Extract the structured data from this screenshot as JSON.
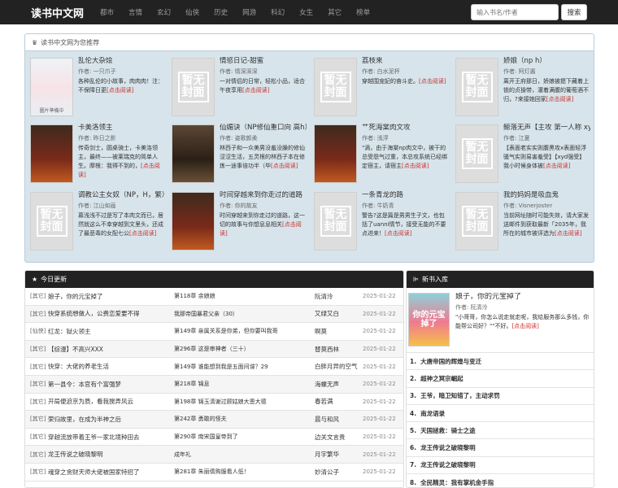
{
  "nav": {
    "brand": "读书中文网",
    "items": [
      "都市",
      "言情",
      "玄幻",
      "仙侠",
      "历史",
      "网游",
      "科幻",
      "女生",
      "其它",
      "榜单"
    ],
    "search_placeholder": "输入书名/作者",
    "search_button": "搜索"
  },
  "recommend": {
    "title": "读书中文网为您推荐",
    "author_prefix": "作者: ",
    "more_label": "[点击阅读]",
    "cover_text": [
      "暂无",
      "封面"
    ],
    "books": [
      {
        "title": "乱伦大杂烩",
        "author": "一只爪子",
        "desc": "各种乱伦的小故事，肉肉肉！注：不保障日更",
        "cover": "image",
        "cover_caption": "圖片準備中"
      },
      {
        "title": "情慾日记-甜蜜",
        "author": "情深深深",
        "desc": "一对情侣的日常，轻松小品，适合午夜享用",
        "cover": "none"
      },
      {
        "title": "荔枝来",
        "author": "白水泥杯",
        "desc": "穿越围宠妃的奋斗史。",
        "cover": "none"
      },
      {
        "title": "娇娘（np h）",
        "author": "阿灯酱",
        "desc": "离开王府那日，娇娘被摁下藏着上锁的贞操带，灌着满腹的葡萄酒不归，?来接她回家",
        "cover": "none"
      },
      {
        "title": "卡美洛领主",
        "author": "昨日之影",
        "desc": "传奇剑士，圆桌骑士，卡美洛领主，最终——被莱瑞克的简单人生。摩根：我得不到的，",
        "cover": "image"
      },
      {
        "title": "仙媚诀（NP修仙重口向 高h）",
        "author": "姿歌颜柔",
        "desc": "林西子和一众美男没羞没臊的修仙涩涩生活，五灵根的林西子本在修炼一途事倍功半（毕",
        "cover": "image"
      },
      {
        "title": "艹死海棠肉文攻",
        "author": "浅浮",
        "desc": "\"滴，由于海棠np肉文中，被干的总受怨气过重，本总攻系统已经绑定宿主，请宿主",
        "cover": "image"
      },
      {
        "title": "鲸落无声【主攻 第一人称 xyd强受】",
        "author": "江夏",
        "desc": "【表面老实实则腹黑攻x表面轻浮骚气实则易害羞受】【xyd强受】我小时候身体被",
        "cover": "none"
      },
      {
        "title": "调教公主女奴（NP，H，繁）",
        "author": "江山如画",
        "desc": "慕浅浅不过是写了本肉文而已，居然就这么不幸穿越到文里头，还成了最恶毒的女配七公",
        "cover": "none"
      },
      {
        "title": "时间穿越来到你走过的道路",
        "author": "你的故友",
        "desc": "时间穿越来到你走过的道路，这一切的故事与你想息息相关",
        "cover": "image"
      },
      {
        "title": "一条青龙的路",
        "author": "牛奶青",
        "desc": "警告?这是篇是男男生子文，也包括了uanni情节，接受无能的不要点进来！",
        "cover": "none"
      },
      {
        "title": "我的妈妈是吸血鬼",
        "author": "Visnerjoster",
        "desc": "当前网址随时可能失效，请大家发送邮件到获取最新「2035年，我所在的城市被评选为",
        "cover": "none"
      }
    ]
  },
  "updates": {
    "title": "今日更新",
    "rows": [
      {
        "cat": "[其它]",
        "book": "娘子，你的元宝掉了",
        "chapter": "第118章 余娘娘",
        "author": "阮清泠",
        "date": "2025-01-22"
      },
      {
        "cat": "[其它]",
        "book": "快穿系统想做人，公费恋爱要不得",
        "chapter": "我那帝国暴君父亲（30）",
        "author": "又绿又白",
        "date": "2025-01-22"
      },
      {
        "cat": "[仙侠]",
        "book": "红龙：狱火领主",
        "chapter": "第149章 亲属关系是你弟，但你要叫我哥",
        "author": "啊莫",
        "date": "2025-01-22"
      },
      {
        "cat": "[其它]",
        "book": "【综漫】不高兴XXX",
        "chapter": "第296章 这是审神者（三十）",
        "author": "替莫西林",
        "date": "2025-01-22"
      },
      {
        "cat": "[其它]",
        "book": "快穿：大佬的养老生活",
        "chapter": "第149章 谁能想到我是五面间谍？29",
        "author": "白胖月异的空气",
        "date": "2025-01-22"
      },
      {
        "cat": "[其它]",
        "book": "第一县令：本官有个富强梦",
        "chapter": "第218章 锦息",
        "author": "海螺无声",
        "date": "2025-01-22"
      },
      {
        "cat": "[其它]",
        "book": "开局便迫京为质，看我搅弄风云",
        "chapter": "第198章 锦玉清谢过顾姑娘大恩大德",
        "author": "春若满",
        "date": "2025-01-22"
      },
      {
        "cat": "[其它]",
        "book": "荣归故里，在成为半神之后",
        "chapter": "第242章 勇敢的怪夫",
        "author": "晨与和风",
        "date": "2025-01-22"
      },
      {
        "cat": "[其它]",
        "book": "穿越流放带着王爷一家北境种田去",
        "chapter": "第290章 南宋国皇帝到了",
        "author": "边关文言贵",
        "date": "2025-01-22"
      },
      {
        "cat": "[其它]",
        "book": "龙王传说之破晓黎明",
        "chapter": "成年礼",
        "author": "月宇繁华",
        "date": "2025-01-22"
      },
      {
        "cat": "[其它]",
        "book": "魂穿之贪财天师大佬被国家特招了",
        "chapter": "第281章 朱丽倩购服看人低！",
        "author": "妙清公子",
        "date": "2025-01-22"
      }
    ]
  },
  "newbooks": {
    "title": "新书入库",
    "featured": {
      "title": "娘子，你的元宝掉了",
      "author": "阮清泠",
      "desc": "\"小哥哥，你怎么说走就走呢，我给服务那么多钱，你能帮公司好？\"\"不好。",
      "more": "[点击阅读]",
      "cover_text": "你的元宝掉了"
    },
    "items": [
      {
        "num": "1.",
        "title": "大唐帝国的辉煌与变迁"
      },
      {
        "num": "2.",
        "title": "超神之冥宗崛起"
      },
      {
        "num": "3.",
        "title": "王爷，暗卫知错了，主动求罚"
      },
      {
        "num": "4.",
        "title": "南龙语录"
      },
      {
        "num": "5.",
        "title": "天国拯救：骑士之途"
      },
      {
        "num": "6.",
        "title": "龙王传说之破晓黎明"
      },
      {
        "num": "7.",
        "title": "龙王传说之破晓黎明"
      },
      {
        "num": "8.",
        "title": "全民精灵：我有掌机金手指"
      }
    ]
  }
}
